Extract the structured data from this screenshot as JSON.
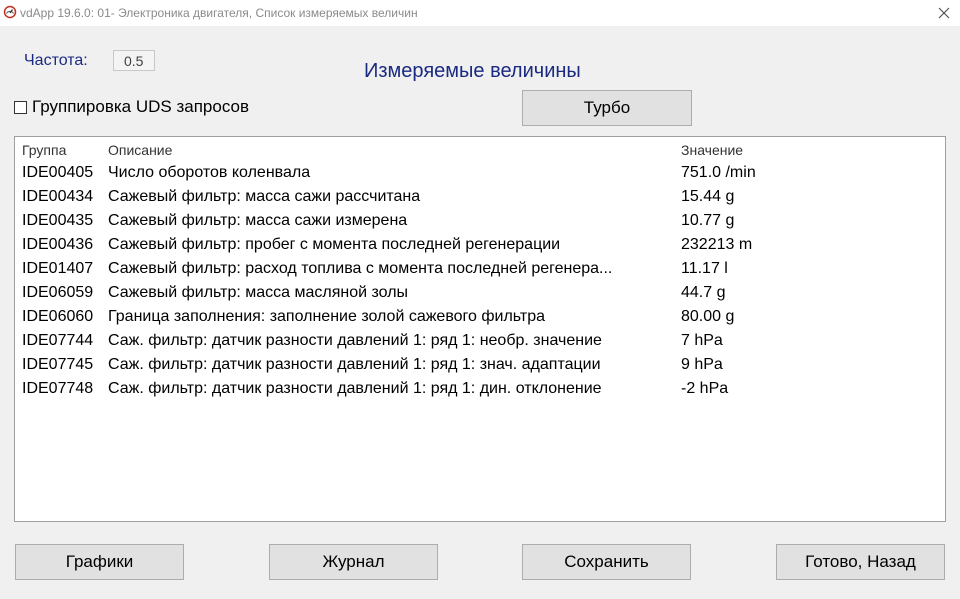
{
  "window": {
    "title": "vdApp 19.6.0: 01- Электроника двигателя,  Список измеряемых величин",
    "app_icon": "gauge-icon",
    "close_icon": "close-icon"
  },
  "frequency": {
    "label": "Частота:",
    "value": "0.5"
  },
  "page_title": "Измеряемые величины",
  "uds_grouping": {
    "label": "Группировка UDS запросов",
    "checked": false
  },
  "turbo_button": "Турбо",
  "table": {
    "columns": [
      "Группа",
      "Описание",
      "Значение"
    ],
    "rows": [
      {
        "group": "IDE00405",
        "description": "Число оборотов коленвала",
        "value": "751.0 /min"
      },
      {
        "group": "IDE00434",
        "description": "Сажевый фильтр: масса сажи рассчитана",
        "value": "15.44 g"
      },
      {
        "group": "IDE00435",
        "description": "Сажевый фильтр: масса сажи измерена",
        "value": "10.77 g"
      },
      {
        "group": "IDE00436",
        "description": "Сажевый фильтр: пробег с момента последней регенерации",
        "value": "232213 m"
      },
      {
        "group": "IDE01407",
        "description": "Сажевый фильтр: расход топлива с момента последней регенера...",
        "value": "11.17 l"
      },
      {
        "group": "IDE06059",
        "description": "Сажевый фильтр: масса масляной золы",
        "value": "44.7 g"
      },
      {
        "group": "IDE06060",
        "description": "Граница заполнения: заполнение золой сажевого фильтра",
        "value": "80.00 g"
      },
      {
        "group": "IDE07744",
        "description": "Саж. фильтр: датчик разности давлений 1: ряд 1: необр. значение",
        "value": "7 hPa"
      },
      {
        "group": "IDE07745",
        "description": "Саж. фильтр: датчик разности давлений 1: ряд 1: знач. адаптации",
        "value": "9 hPa"
      },
      {
        "group": "IDE07748",
        "description": "Саж. фильтр: датчик разности давлений 1: ряд 1: дин. отклонение",
        "value": "-2 hPa"
      }
    ]
  },
  "buttons": {
    "graphs": "Графики",
    "journal": "Журнал",
    "save": "Сохранить",
    "done_back": "Готово, Назад"
  },
  "colors": {
    "accent_text": "#1a2a80",
    "window_bg": "#f0f0f0",
    "button_bg": "#e1e1e1"
  }
}
